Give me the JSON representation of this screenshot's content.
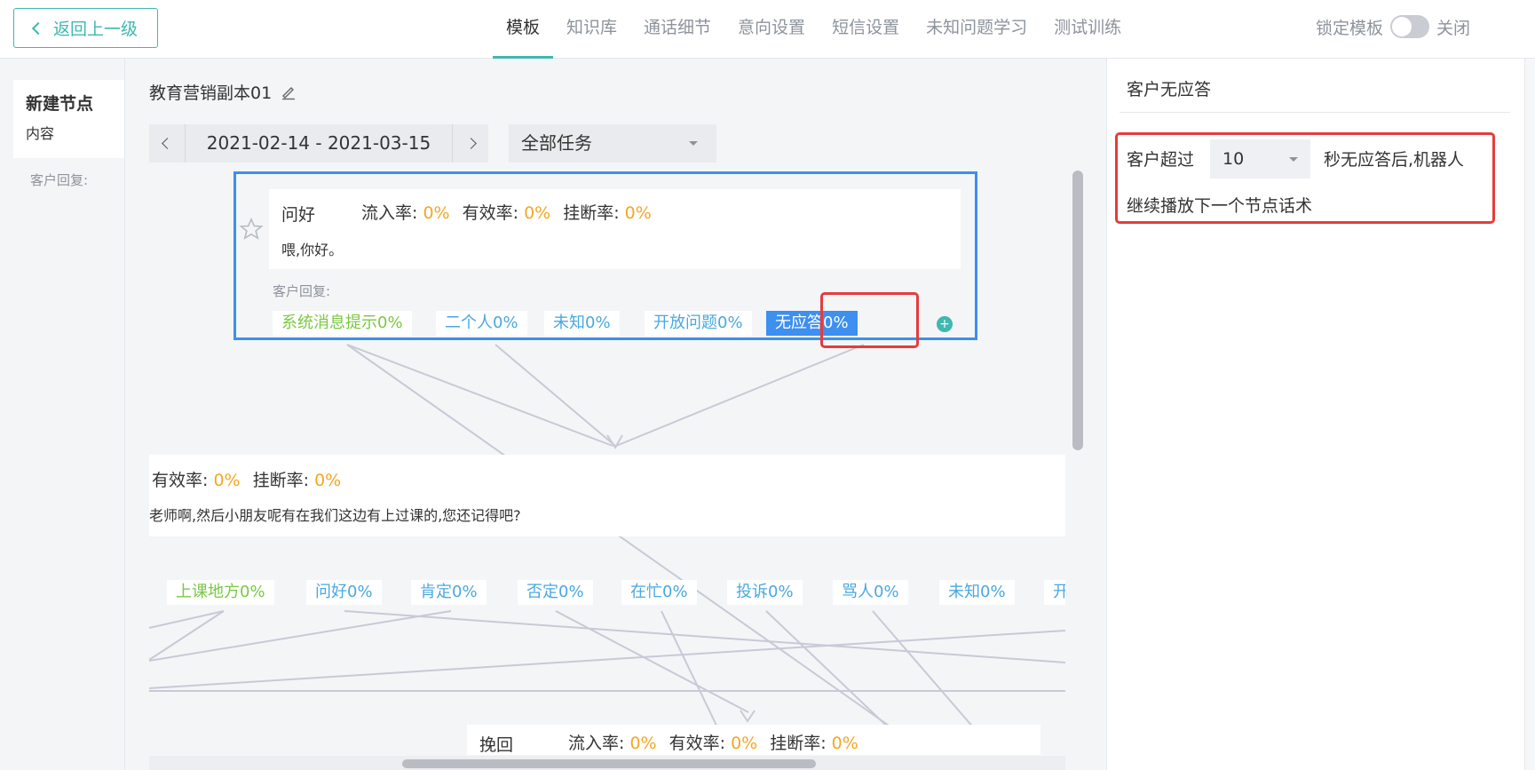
{
  "topbar": {
    "back_label": "返回上一级",
    "tabs": [
      "模板",
      "知识库",
      "通话细节",
      "意向设置",
      "短信设置",
      "未知问题学习",
      "测试训练"
    ],
    "lock_label": "锁定模板",
    "lock_state": "关闭"
  },
  "sidebar": {
    "node_title": "新建节点",
    "node_sub": "内容",
    "reply_label": "客户回复:"
  },
  "main": {
    "doc_title": "教育营销副本01",
    "date_range": "2021-02-14 - 2021-03-15",
    "task_filter": "全部任务"
  },
  "node1": {
    "title": "问好",
    "inflow_label": "流入率:",
    "inflow_value": "0%",
    "valid_label": "有效率:",
    "valid_value": "0%",
    "hangup_label": "挂断率:",
    "hangup_value": "0%",
    "text": "喂,你好。",
    "reply_label": "客户回复:",
    "chips": [
      "系统消息提示0%",
      "二个人0%",
      "未知0%",
      "开放问题0%",
      "无应答0%"
    ]
  },
  "node2": {
    "valid_label": "有效率:",
    "valid_value": "0%",
    "hangup_label": "挂断率:",
    "hangup_value": "0%",
    "text": "老师啊,然后小朋友呢有在我们这边有上过课的,您还记得吧?",
    "chips": [
      "上课地方0%",
      "问好0%",
      "肯定0%",
      "否定0%",
      "在忙0%",
      "投诉0%",
      "骂人0%",
      "未知0%",
      "开"
    ]
  },
  "node3": {
    "title": "挽回",
    "inflow_label": "流入率:",
    "inflow_value": "0%",
    "valid_label": "有效率:",
    "valid_value": "0%",
    "hangup_label": "挂断率:",
    "hangup_value": "0%"
  },
  "rpanel": {
    "title": "客户无应答",
    "prefix": "客户超过",
    "seconds": "10",
    "suffix": "秒无应答后,机器人",
    "line2": "继续播放下一个节点话术"
  },
  "colors": {
    "accent": "#3fb8b0",
    "rate": "#f5a623",
    "selected": "#3d8ff0",
    "highlight": "#e53c3c"
  }
}
